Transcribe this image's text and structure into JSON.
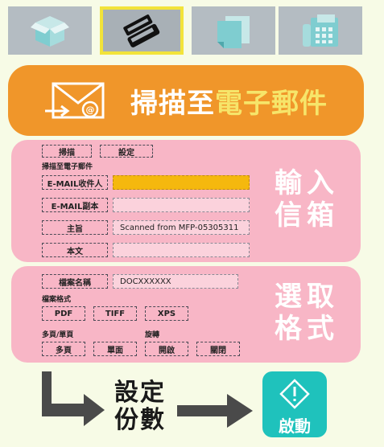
{
  "modes": [
    {
      "name": "box-icon",
      "active": false
    },
    {
      "name": "scanner-icon",
      "active": true
    },
    {
      "name": "documents-icon",
      "active": false
    },
    {
      "name": "fax-icon",
      "active": false
    }
  ],
  "banner": {
    "title_main": "掃描至",
    "title_highlight": "電子郵件"
  },
  "email_panel": {
    "tab_scan": "掃描",
    "tab_settings": "設定",
    "section_label": "掃描至電子郵件",
    "fields": [
      {
        "label": "E-MAIL收件人",
        "value": ""
      },
      {
        "label": "E-MAIL副本",
        "value": ""
      },
      {
        "label": "主旨",
        "value": "Scanned from MFP-05305311"
      },
      {
        "label": "本文",
        "value": ""
      }
    ],
    "side_text_line1": "輸入",
    "side_text_line2": "信箱"
  },
  "format_panel": {
    "filename_label": "檔案名稱",
    "filename_value": "DOCXXXXXX",
    "format_section": "檔案格式",
    "formats": [
      "PDF",
      "TIFF",
      "XPS"
    ],
    "page_section": "多頁/單頁",
    "page_options": [
      "多頁",
      "單面"
    ],
    "rotate_section": "旋轉",
    "rotate_options": [
      "開啟",
      "關閉"
    ],
    "side_text_line1": "選取",
    "side_text_line2": "格式"
  },
  "flow": {
    "copies_line1": "設定",
    "copies_line2": "份數",
    "start_label": "啟動"
  },
  "colors": {
    "banner": "#f0962a",
    "panel": "#f8b6c6",
    "active_border": "#f2e33a",
    "highlight_field": "#f5b80e",
    "start": "#1fc2bc"
  }
}
